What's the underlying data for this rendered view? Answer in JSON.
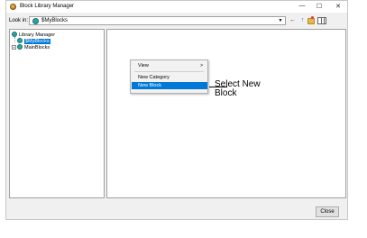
{
  "window": {
    "title": "Block Library Manager",
    "controls": {
      "minimize": "—",
      "maximize": "☐",
      "close": "✕"
    }
  },
  "toolbar": {
    "look_in_label": "Look in:",
    "look_in_value": "$MyBlocks",
    "icons": [
      "back-arrow-icon",
      "up-arrow-icon",
      "new-folder-icon",
      "view-menu-icon"
    ]
  },
  "tree": {
    "root": "Library Manager",
    "children": [
      "$MyBlocks",
      "MainBlocks"
    ],
    "selected": "$MyBlocks"
  },
  "context_menu": {
    "items": [
      {
        "label": "View",
        "submenu_glyph": ">"
      },
      {
        "label": "New Category"
      },
      {
        "label": "New Block",
        "highlighted": true
      }
    ]
  },
  "callout": {
    "line1": "Select New",
    "line2": "Block"
  },
  "footer": {
    "close_label": "Close"
  },
  "colors": {
    "selection": "#0078d7",
    "window_bg": "#f0f0f0"
  }
}
